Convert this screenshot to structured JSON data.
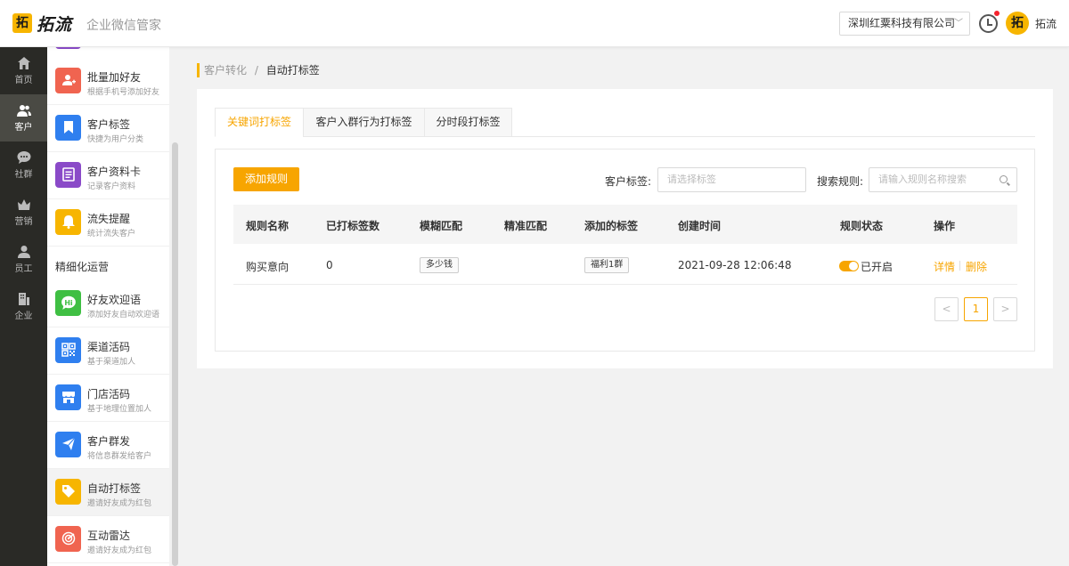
{
  "header": {
    "logo_mark": "拓",
    "logo_text": "拓流",
    "subtitle": "企业微信管家",
    "company": "深圳红粟科技有限公司",
    "user_avatar": "拓",
    "user_name": "拓流"
  },
  "nav": {
    "items": [
      {
        "label": "首页",
        "icon": "home-icon"
      },
      {
        "label": "客户",
        "icon": "users-icon"
      },
      {
        "label": "社群",
        "icon": "chat-icon"
      },
      {
        "label": "营销",
        "icon": "crown-icon"
      },
      {
        "label": "员工",
        "icon": "person-icon"
      },
      {
        "label": "企业",
        "icon": "building-icon"
      }
    ],
    "active": "客户"
  },
  "submenu": {
    "items": [
      {
        "title": "批量加好友",
        "desc": "根据手机号添加好友",
        "icon": "add-user-icon",
        "color": "#f06450"
      },
      {
        "title": "客户标签",
        "desc": "快捷为用户分类",
        "icon": "bookmark-icon",
        "color": "#2f7fef"
      },
      {
        "title": "客户资料卡",
        "desc": "记录客户资料",
        "icon": "card-icon",
        "color": "#8a4ac8"
      },
      {
        "title": "流失提醒",
        "desc": "统计流失客户",
        "icon": "bell-icon",
        "color": "#f7b500"
      }
    ],
    "section": "精细化运营",
    "items2": [
      {
        "title": "好友欢迎语",
        "desc": "添加好友自动欢迎语",
        "icon": "hi-icon",
        "color": "#3fbf43"
      },
      {
        "title": "渠道活码",
        "desc": "基于渠道加人",
        "icon": "qr-icon",
        "color": "#2f7fef"
      },
      {
        "title": "门店活码",
        "desc": "基于地理位置加人",
        "icon": "store-icon",
        "color": "#2f7fef"
      },
      {
        "title": "客户群发",
        "desc": "将信息群发给客户",
        "icon": "send-icon",
        "color": "#2f7fef"
      },
      {
        "title": "自动打标签",
        "desc": "邀请好友成为红包",
        "icon": "tag-icon",
        "color": "#f7b500"
      },
      {
        "title": "互动雷达",
        "desc": "邀请好友成为红包",
        "icon": "radar-icon",
        "color": "#f06450"
      }
    ]
  },
  "breadcrumb": {
    "parent": "客户转化",
    "sep": "/",
    "current": "自动打标签"
  },
  "tabs": [
    "关键词打标签",
    "客户入群行为打标签",
    "分时段打标签"
  ],
  "toolbar": {
    "add_label": "添加规则",
    "tag_filter_label": "客户标签:",
    "tag_filter_placeholder": "请选择标签",
    "search_label": "搜索规则:",
    "search_placeholder": "请输入规则名称搜索"
  },
  "table": {
    "columns": [
      "规则名称",
      "已打标签数",
      "模糊匹配",
      "精准匹配",
      "添加的标签",
      "创建时间",
      "规则状态",
      "操作"
    ],
    "rows": [
      {
        "name": "购买意向",
        "count": "0",
        "fuzzy": "多少钱",
        "exact": "",
        "tag": "福利1群",
        "created": "2021-09-28 12:06:48",
        "status": "已开启",
        "actions": [
          "详情",
          "删除"
        ]
      }
    ]
  },
  "pager": {
    "prev": "<",
    "page": "1",
    "next": ">"
  },
  "colors": {
    "accent": "#f7a500",
    "brand": "#f7b500",
    "sidebar": "#2a2a26"
  }
}
